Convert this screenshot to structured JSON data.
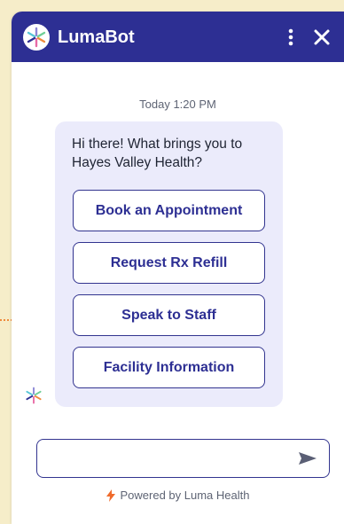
{
  "header": {
    "title": "LumaBot",
    "avatar_icon": "luma-logo-icon",
    "more_icon": "more-vertical-icon",
    "close_icon": "close-icon",
    "color": "#2d2f93"
  },
  "chat": {
    "timestamp": "Today 1:20 PM",
    "message": "Hi there! What brings you to Hayes Valley Health?",
    "options": [
      "Book an Appointment",
      "Request Rx Refill",
      "Speak to Staff",
      "Facility Information"
    ],
    "bubble_color": "#ebebfb"
  },
  "composer": {
    "placeholder": "",
    "value": "",
    "send_icon": "send-icon"
  },
  "footer": {
    "powered_by": "Powered by Luma Health",
    "bolt_icon": "lightning-bolt-icon"
  },
  "indicator": {
    "color": "#ef8a3c"
  }
}
